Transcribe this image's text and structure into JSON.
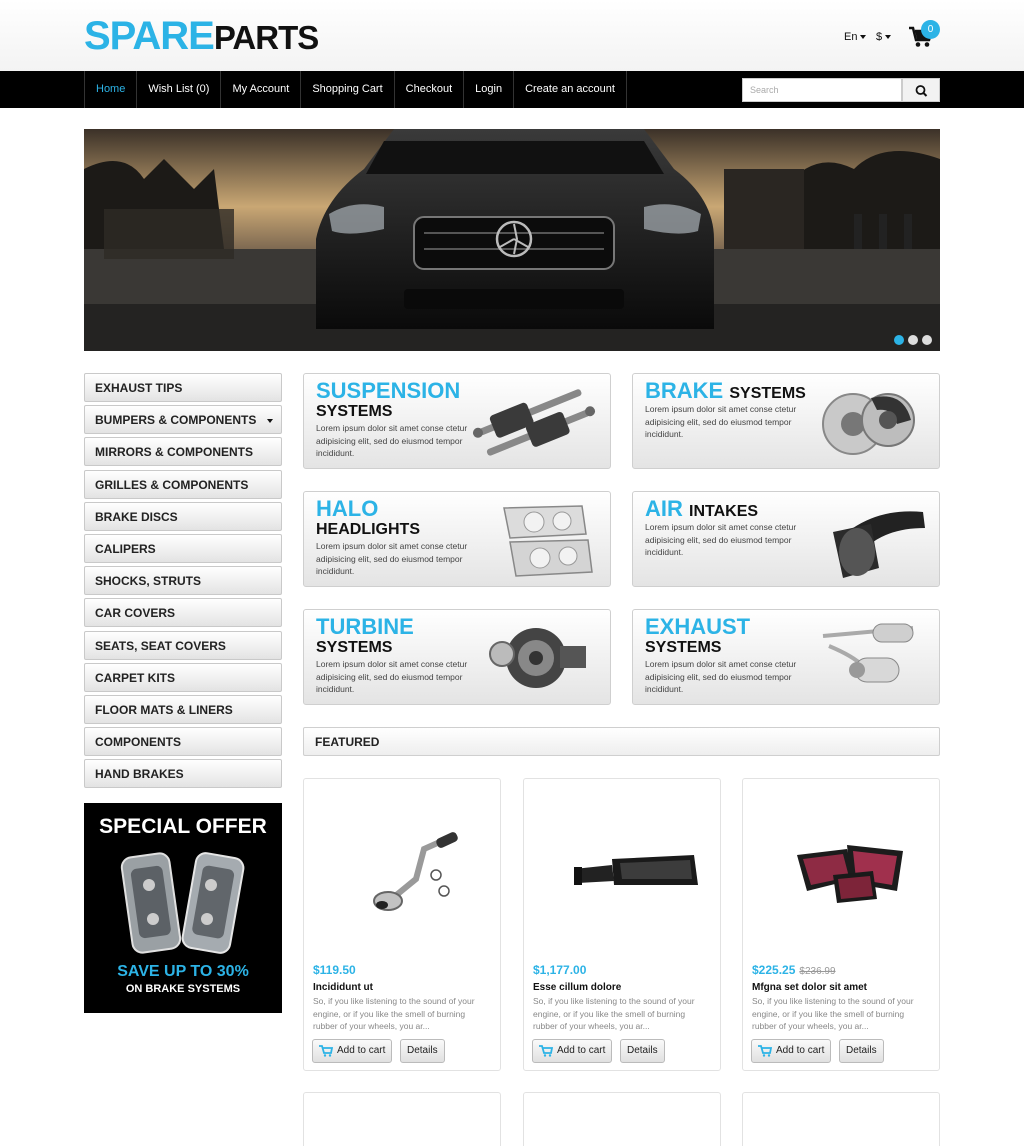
{
  "header": {
    "logo_part1": "SPARE",
    "logo_part2": "PARTS",
    "language": "En",
    "currency": "$",
    "cart_count": "0"
  },
  "nav": {
    "items": [
      "Home",
      "Wish List (0)",
      "My Account",
      "Shopping Cart",
      "Checkout",
      "Login",
      "Create an account"
    ],
    "active": "Home",
    "search_placeholder": "Search"
  },
  "slider": {
    "slides": 3,
    "active_slide": 1
  },
  "sidebar": {
    "categories": [
      "EXHAUST TIPS",
      "BUMPERS & COMPONENTS",
      "MIRRORS & COMPONENTS",
      "GRILLES & COMPONENTS",
      "BRAKE DISCS",
      "CALIPERS",
      "SHOCKS, STRUTS",
      "CAR COVERS",
      "SEATS, SEAT COVERS",
      "CARPET KITS",
      "FLOOR MATS & LINERS",
      "COMPONENTS",
      "HAND BRAKES"
    ],
    "offer": {
      "title": "SPECIAL OFFER",
      "save": "SAVE UP TO 30%",
      "sub": "ON BRAKE SYSTEMS"
    }
  },
  "banners": [
    {
      "highlight": "SUSPENSION",
      "rest": "SYSTEMS",
      "text": "Lorem ipsum dolor sit amet conse ctetur adipisicing elit, sed do eiusmod tempor incididunt."
    },
    {
      "highlight": "BRAKE",
      "rest": "SYSTEMS",
      "text": "Lorem ipsum dolor sit amet conse ctetur adipisicing elit, sed do eiusmod tempor incididunt."
    },
    {
      "highlight": "HALO",
      "rest": "HEADLIGHTS",
      "text": "Lorem ipsum dolor sit amet conse ctetur adipisicing elit, sed do eiusmod tempor incididunt."
    },
    {
      "highlight": "AIR",
      "rest": "INTAKES",
      "text": "Lorem ipsum dolor sit amet conse ctetur adipisicing elit, sed do eiusmod tempor incididunt."
    },
    {
      "highlight": "TURBINE",
      "rest": "SYSTEMS",
      "text": "Lorem ipsum dolor sit amet conse ctetur adipisicing elit, sed do eiusmod tempor incididunt."
    },
    {
      "highlight": "EXHAUST",
      "rest": "SYSTEMS",
      "text": "Lorem ipsum dolor sit amet conse ctetur adipisicing elit, sed do eiusmod tempor incididunt."
    }
  ],
  "featured": {
    "title": "FEATURED",
    "products": [
      {
        "price": "$119.50",
        "old_price": "",
        "name": "Incididunt ut",
        "desc": "So, if you like listening to the sound of your engine, or if you like the smell of burning rubber of your wheels, you ar..."
      },
      {
        "price": "$1,177.00",
        "old_price": "",
        "name": "Esse cillum dolore",
        "desc": "So, if you like listening to the sound of your engine, or if you like the smell of burning rubber of your wheels, you ar..."
      },
      {
        "price": "$225.25",
        "old_price": "$236.99",
        "name": "Mfgna set dolor sit amet",
        "desc": "So, if you like listening to the sound of your engine, or if you like the smell of burning rubber of your wheels, you ar..."
      }
    ],
    "add_to_cart_label": "Add to cart",
    "details_label": "Details"
  },
  "colors": {
    "accent": "#2cb3e6",
    "nav_bg": "#000000",
    "offer_bg": "#000000"
  }
}
